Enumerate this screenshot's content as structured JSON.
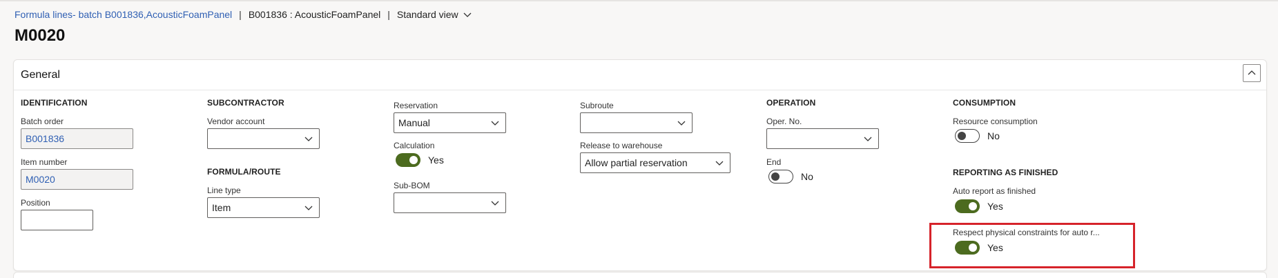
{
  "breadcrumb": {
    "link": "Formula lines- batch B001836,AcousticFoamPanel",
    "separator": "|",
    "record": "B001836 : AcousticFoamPanel",
    "view": "Standard view"
  },
  "page_title": "M0020",
  "card": {
    "title": "General"
  },
  "identification": {
    "title": "IDENTIFICATION",
    "batch_order_label": "Batch order",
    "batch_order_value": "B001836",
    "item_number_label": "Item number",
    "item_number_value": "M0020",
    "position_label": "Position",
    "position_value": ""
  },
  "subcontractor": {
    "title": "SUBCONTRACTOR",
    "vendor_account_label": "Vendor account",
    "vendor_account_value": ""
  },
  "formula_route": {
    "title": "FORMULA/ROUTE",
    "line_type_label": "Line type",
    "line_type_value": "Item"
  },
  "reservation": {
    "reservation_label": "Reservation",
    "reservation_value": "Manual",
    "calculation_label": "Calculation",
    "calculation_state": "Yes",
    "sub_bom_label": "Sub-BOM",
    "sub_bom_value": ""
  },
  "subroute": {
    "subroute_label": "Subroute",
    "subroute_value": "",
    "release_label": "Release to warehouse",
    "release_value": "Allow partial reservation"
  },
  "operation": {
    "title": "OPERATION",
    "oper_no_label": "Oper. No.",
    "oper_no_value": "",
    "end_label": "End",
    "end_state": "No"
  },
  "consumption": {
    "title": "CONSUMPTION",
    "resource_label": "Resource consumption",
    "resource_state": "No"
  },
  "reporting": {
    "title": "REPORTING AS FINISHED",
    "auto_report_label": "Auto report as finished",
    "auto_report_state": "Yes",
    "respect_label": "Respect physical constraints for auto r...",
    "respect_state": "Yes"
  },
  "colors": {
    "link": "#2f5fb3",
    "toggle_on": "#4c6b1f",
    "highlight": "#d6232a"
  }
}
